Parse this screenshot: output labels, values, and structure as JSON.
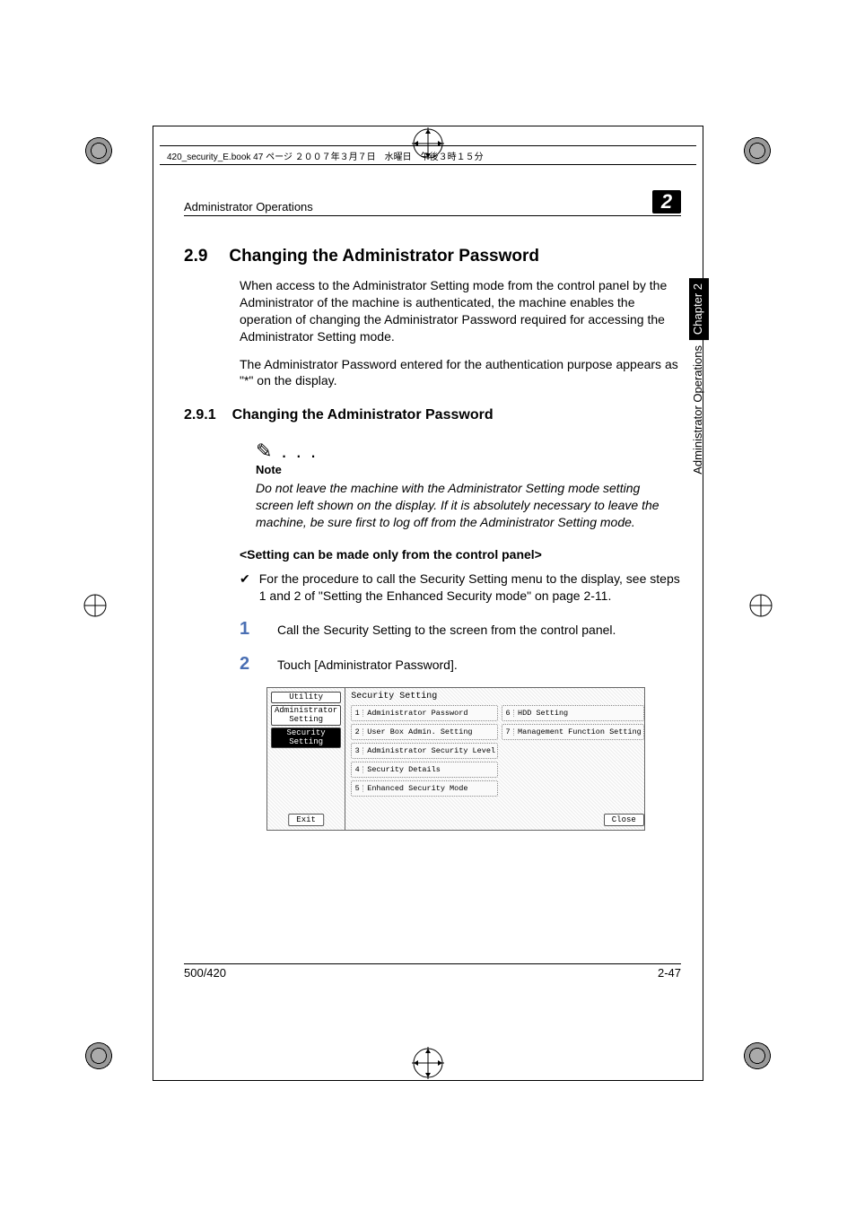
{
  "book_strip": "420_security_E.book  47 ページ  ２００７年３月７日　水曜日　午後３時１５分",
  "running_header_left": "Administrator Operations",
  "chapter_badge": "2",
  "section": {
    "number": "2.9",
    "title": "Changing the Administrator Password"
  },
  "para1": "When access to the Administrator Setting mode from the control panel by the Administrator of the machine is authenticated, the machine enables the operation of changing the Administrator Password required for accessing the Administrator Setting mode.",
  "para2": "The Administrator Password entered for the authentication purpose appears as \"*\" on the display.",
  "subsection": {
    "number": "2.9.1",
    "title": "Changing the Administrator Password"
  },
  "note_icon": "✎ . . .",
  "note_label": "Note",
  "note_text": "Do not leave the machine with the Administrator Setting mode setting screen left shown on the display. If it is absolutely necessary to leave the machine, be sure first to log off from the Administrator Setting mode.",
  "sub_bold": "<Setting can be made only from the control panel>",
  "check_mark": "✔",
  "check_text": "For the procedure to call the Security Setting menu to the display, see steps 1 and 2 of \"Setting the Enhanced Security mode\" on page 2-11.",
  "steps": [
    {
      "num": "1",
      "text": "Call the Security Setting to the screen from the control panel."
    },
    {
      "num": "2",
      "text": "Touch [Administrator Password]."
    }
  ],
  "panel": {
    "left_tabs": [
      "Utility",
      "Administrator\nSetting",
      "Security Setting"
    ],
    "selected_tab_index": 2,
    "title": "Security Setting",
    "options_left": [
      {
        "n": "1",
        "label": "Administrator\nPassword"
      },
      {
        "n": "2",
        "label": "User Box\nAdmin. Setting"
      },
      {
        "n": "3",
        "label": "Administrator\nSecurity Level"
      },
      {
        "n": "4",
        "label": "Security Details"
      },
      {
        "n": "5",
        "label": "Enhanced Security\nMode"
      }
    ],
    "options_right": [
      {
        "n": "6",
        "label": "HDD Setting"
      },
      {
        "n": "7",
        "label": "Management\nFunction Setting"
      }
    ],
    "exit": "Exit",
    "close": "Close"
  },
  "footer_left": "500/420",
  "footer_right": "2-47",
  "side_tab_dark": "Chapter 2",
  "side_tab_light": "Administrator Operations"
}
